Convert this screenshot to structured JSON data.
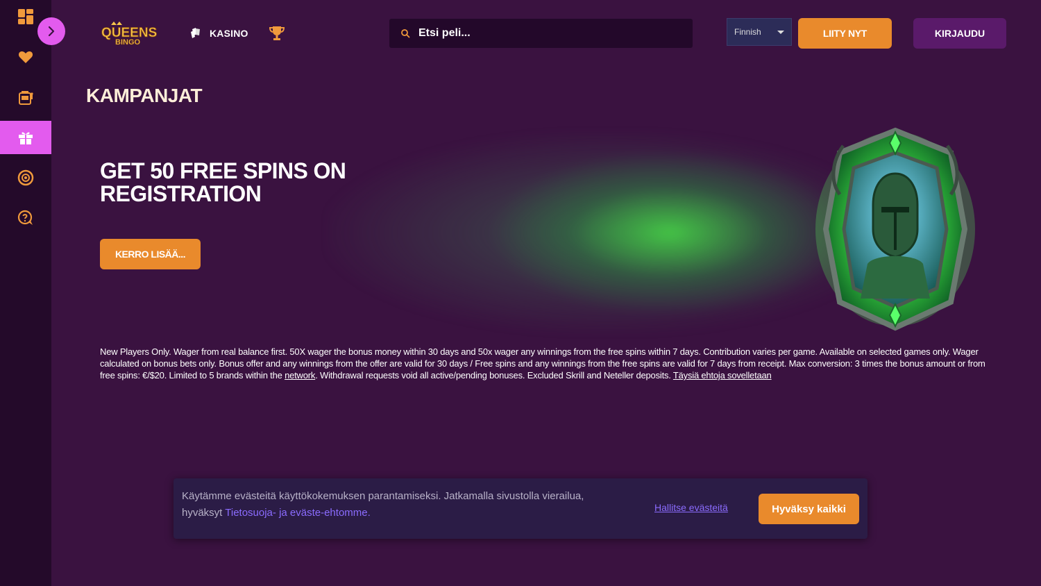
{
  "sidebar": {
    "items": [
      {
        "name": "dashboard"
      },
      {
        "name": "favorites"
      },
      {
        "name": "slots"
      },
      {
        "name": "promotions"
      },
      {
        "name": "live-casino"
      },
      {
        "name": "support"
      }
    ]
  },
  "header": {
    "logo_text_top": "QUEENS",
    "logo_text_bottom": "BINGO",
    "nav_kasino": "KASINO",
    "search_placeholder": "Etsi peli...",
    "language": "Finnish",
    "join_label": "LIITY NYT",
    "login_label": "KIRJAUDU"
  },
  "page": {
    "title": "KAMPANJAT"
  },
  "promo": {
    "title_line1": "GET 50 FREE SPINS ON",
    "title_line2": "REGISTRATION",
    "button_label": "KERRO LISÄÄ..."
  },
  "terms": {
    "text_1": "New Players Only. Wager from real balance first. 50X wager the bonus money within 30 days and 50x wager any winnings from the free spins within 7 days. Contribution varies per game. Available on selected games only. Wager calculated on bonus bets only. Bonus offer and any winnings from the offer are valid for 30 days / Free spins and any winnings from the free spins are valid for 7 days from receipt. Max conversion: 3 times the bonus amount or from free spins: €/$20. Limited to 5 brands within the ",
    "network_link": "network",
    "text_2": ". Withdrawal requests void all active/pending bonuses. Excluded Skrill and Neteller deposits. ",
    "full_terms_link": "Täysiä ehtoja sovelletaan"
  },
  "cookie": {
    "text": "Käytämme evästeitä käyttökokemuksen parantamiseksi. Jatkamalla sivustolla vierailua, hyväksyt ",
    "policy_link": "Tietosuoja- ja eväste-ehtomme.",
    "manage_label": "Hallitse evästeitä",
    "accept_label": "Hyväksy kaikki"
  },
  "colors": {
    "background": "#3a1240",
    "sidebar": "#240a2a",
    "accent_pink": "#e35bee",
    "accent_orange": "#e98a2c",
    "login_purple": "#5a1a6a",
    "link_violet": "#8b6cff"
  }
}
